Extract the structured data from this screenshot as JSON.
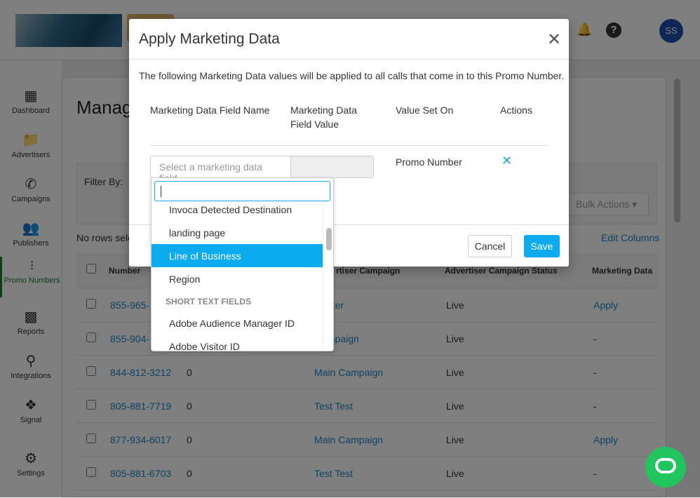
{
  "header": {
    "avatar": "SS",
    "icons": [
      "bell-icon",
      "help-icon"
    ]
  },
  "sidebar": {
    "items": [
      {
        "label": "Dashboard",
        "icon": "dashboard-icon"
      },
      {
        "label": "Advertisers",
        "icon": "folder-icon"
      },
      {
        "label": "Campaigns",
        "icon": "phone-forward-icon"
      },
      {
        "label": "Publishers",
        "icon": "people-icon"
      },
      {
        "label": "Promo Numbers",
        "icon": "dots-grid-icon",
        "active": true
      },
      {
        "label": "Reports",
        "icon": "bar-chart-icon"
      },
      {
        "label": "Integrations",
        "icon": "network-icon"
      },
      {
        "label": "Signal",
        "icon": "compass-icon"
      },
      {
        "label": "Settings",
        "icon": "gear-icon"
      }
    ]
  },
  "page": {
    "title": "Manag",
    "filter_label": "Filter By:",
    "bulk_actions": "Bulk Actions",
    "no_rows": "No rows sele",
    "edit_columns": "Edit Columns"
  },
  "table": {
    "headers": [
      "Number",
      "",
      "rtiser Campaign",
      "Advertiser Campaign Status",
      "Marketing Data"
    ],
    "rows": [
      [
        "855-965-",
        "",
        "Center",
        "Live",
        "Apply"
      ],
      [
        "855-904-",
        "",
        "Campaign",
        "Live",
        "-"
      ],
      [
        "844-812-3212",
        "0",
        "Main Campaign",
        "Live",
        "-"
      ],
      [
        "805-881-7719",
        "0",
        "Test Test",
        "Live",
        "-"
      ],
      [
        "877-934-6017",
        "0",
        "Main Campaign",
        "Live",
        "Apply"
      ],
      [
        "805-881-6703",
        "0",
        "Test Test",
        "Live",
        "-"
      ]
    ]
  },
  "modal": {
    "title": "Apply Marketing Data",
    "description": "The following Marketing Data values will be applied to all calls that come in to this Promo Number.",
    "columns": [
      "Marketing Data Field Name",
      "Marketing Data Field Value",
      "Value Set On",
      "Actions"
    ],
    "select_placeholder": "Select a marketing data field...",
    "value_set_on": "Promo Number",
    "cancel": "Cancel",
    "save": "Save"
  },
  "dropdown": {
    "search_value": "",
    "options": [
      "Invoca Detected Destination",
      "landing page",
      "Line of Business",
      "Region"
    ],
    "highlighted": "Line of Business",
    "group": "SHORT TEXT FIELDS",
    "group_options": [
      "Adobe Audience Manager ID",
      "Adobe Visitor ID"
    ]
  },
  "colors": {
    "accent": "#0aabef",
    "link": "#1a86c7",
    "active_nav": "#1d7a2c"
  }
}
